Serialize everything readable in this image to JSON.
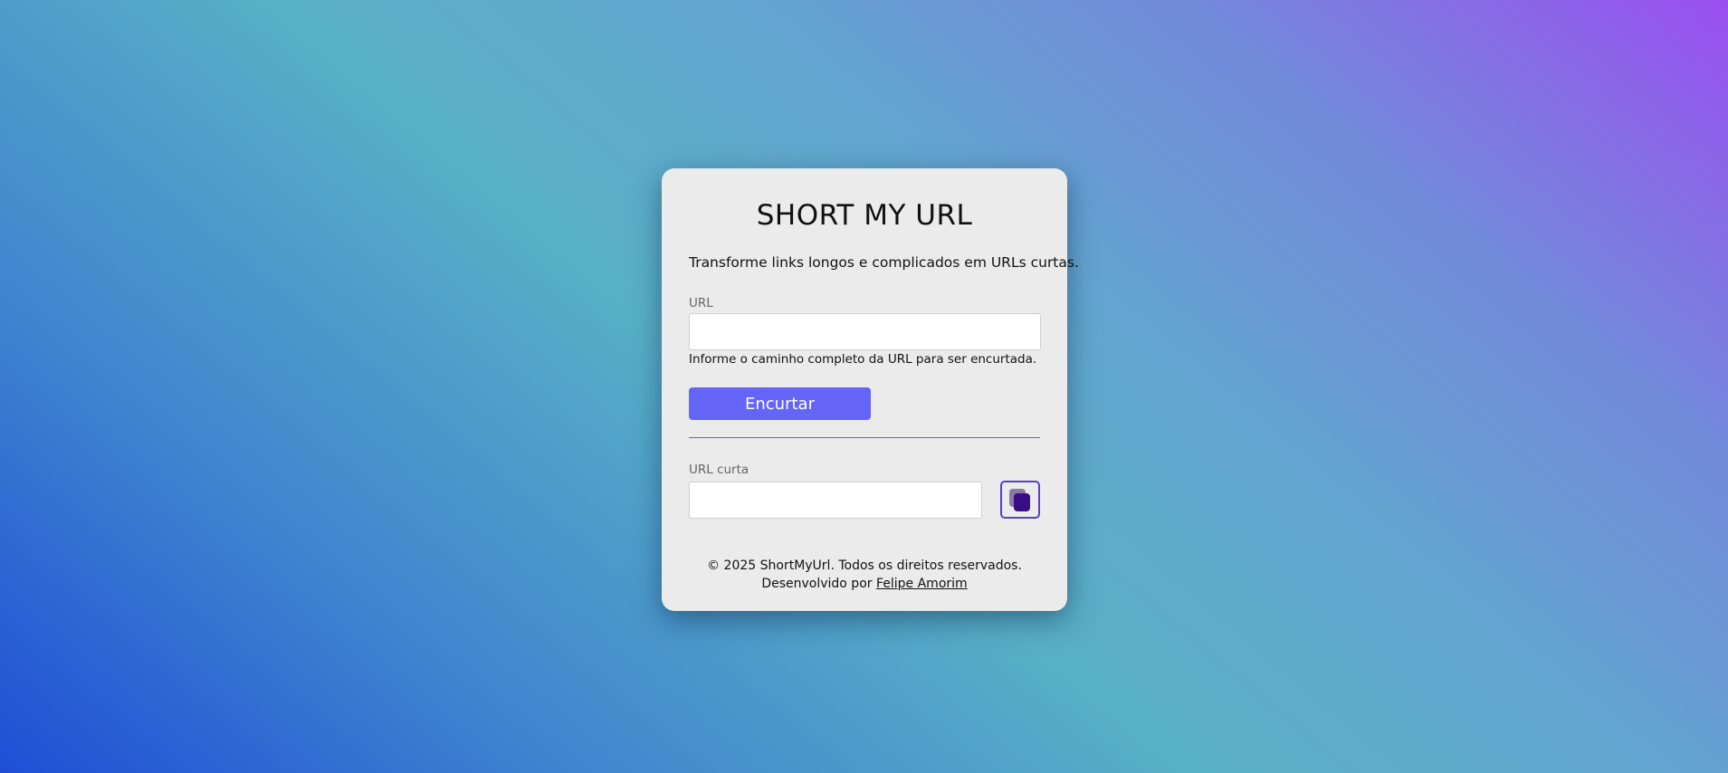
{
  "app": {
    "title": "SHORT MY URL",
    "subtitle": "Transforme links longos e complicados em URLs curtas."
  },
  "form": {
    "url_label": "URL",
    "url_value": "",
    "url_help": "Informe o caminho completo da URL para ser encurtada.",
    "submit_label": "Encurtar"
  },
  "result": {
    "short_url_label": "URL curta",
    "short_url_value": "",
    "copy_icon": "copy-icon"
  },
  "footer": {
    "copyright": "© 2025 ShortMyUrl. Todos os direitos reservados.",
    "developed_by": "Desenvolvido por",
    "author_link": "Felipe Amorim"
  },
  "colors": {
    "accent": "#6464f7",
    "copy_icon": "#3a0f86",
    "card_bg": "#ebebeb"
  }
}
